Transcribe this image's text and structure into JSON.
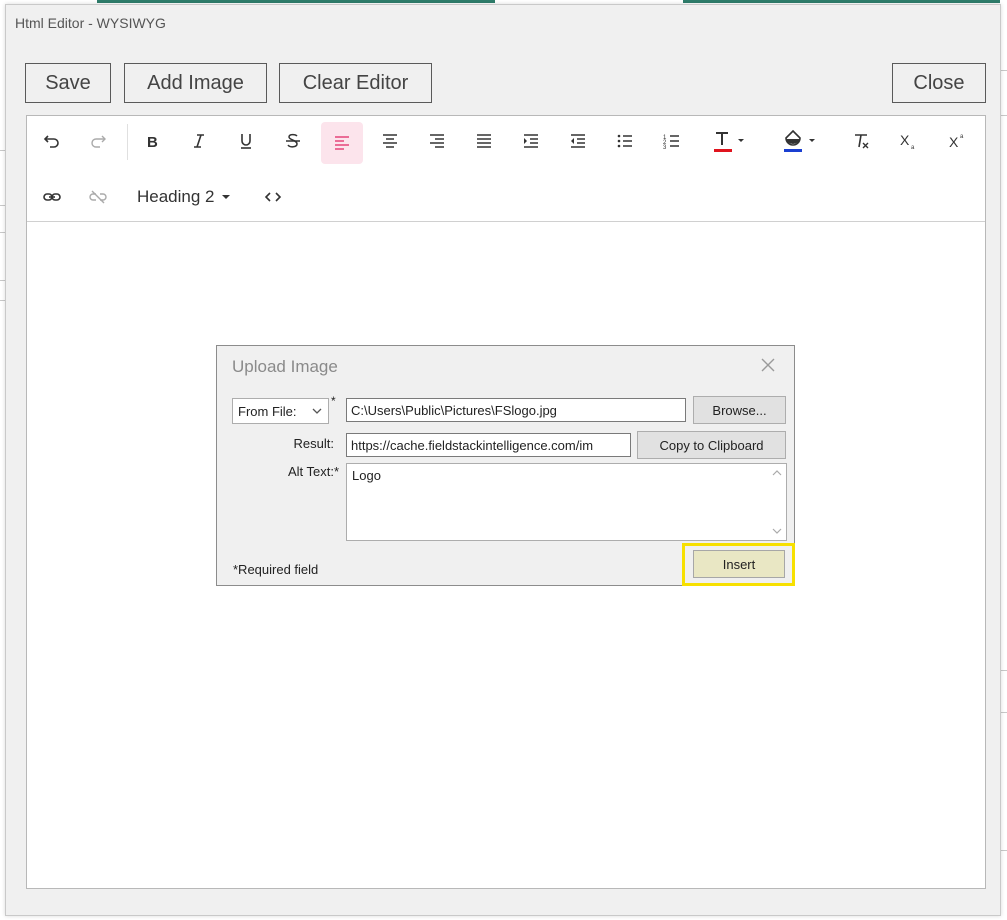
{
  "window": {
    "title": "Html Editor - WYSIWYG"
  },
  "top_buttons": {
    "save": "Save",
    "add_image": "Add Image",
    "clear_editor": "Clear Editor",
    "close": "Close"
  },
  "toolbar": {
    "row1": [
      "undo-icon",
      "redo-icon",
      "bold-icon",
      "italic-icon",
      "underline-icon",
      "strikethrough-icon",
      "align-left-icon",
      "align-center-icon",
      "align-right-icon",
      "align-justify-icon",
      "indent-icon",
      "outdent-icon",
      "bullet-list-icon",
      "numbered-list-icon",
      "text-color-icon",
      "highlight-color-icon",
      "clear-format-icon",
      "subscript-icon",
      "superscript-icon"
    ],
    "row2": [
      "link-icon",
      "unlink-icon",
      "code-view-icon"
    ],
    "active_item": "align-left-icon",
    "heading_dropdown": "Heading 2",
    "text_color": "#e0141e",
    "highlight_color": "#1a3fd1",
    "active_bg": "#fce4ec"
  },
  "dialog": {
    "title": "Upload Image",
    "source_select": "From File:",
    "required_marker": "*",
    "file_path": "C:\\Users\\Public\\Pictures\\FSlogo.jpg",
    "browse_label": "Browse...",
    "result_label": "Result:",
    "result_value": "https://cache.fieldstackintelligence.com/im",
    "copy_label": "Copy to Clipboard",
    "alt_label": "Alt Text:*",
    "alt_value": "Logo",
    "insert_label": "Insert",
    "required_note": "*Required field",
    "highlight_color": "#f7e000"
  }
}
